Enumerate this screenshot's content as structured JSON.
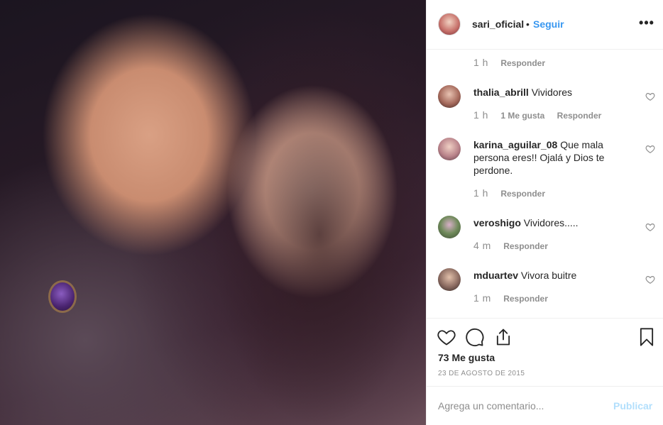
{
  "header": {
    "username": "sari_oficial",
    "separator": "•",
    "follow_label": "Seguir",
    "more_label": "•••"
  },
  "first_meta": {
    "time": "1 h",
    "reply_label": "Responder"
  },
  "comments": [
    {
      "username": "thalia_abrill",
      "text": "Vividores",
      "time": "1 h",
      "likes": "1 Me gusta",
      "reply_label": "Responder"
    },
    {
      "username": "karina_aguilar_08",
      "text": "Que mala persona eres!! Ojalá y Dios te perdone.",
      "time": "1 h",
      "reply_label": "Responder"
    },
    {
      "username": "veroshigo",
      "text": "Vividores.....",
      "time": "4 m",
      "reply_label": "Responder"
    },
    {
      "username": "mduartev",
      "text": "Vivora buitre",
      "time": "1 m",
      "reply_label": "Responder"
    }
  ],
  "actions": {
    "likes_count": "73 Me gusta",
    "date": "23 DE AGOSTO DE 2015",
    "icons": [
      "heart-icon",
      "comment-icon",
      "share-icon",
      "bookmark-icon"
    ]
  },
  "add_comment": {
    "placeholder": "Agrega un comentario...",
    "publish_label": "Publicar"
  },
  "colors": {
    "link_blue": "#3897f0",
    "muted_text": "#8e8e8e",
    "disabled_blue": "#b2dffc"
  }
}
